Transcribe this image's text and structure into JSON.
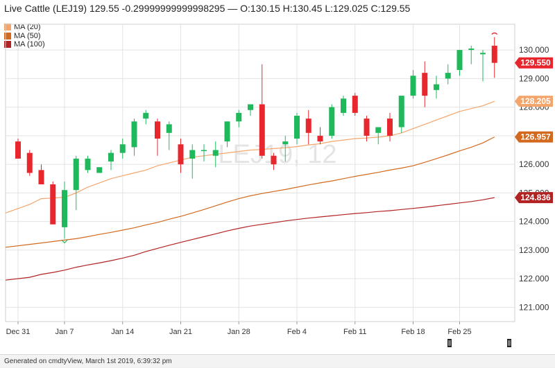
{
  "header": {
    "title": "Live Cattle (LEJ19) 129.55 -0.29999999999998295 — O:130.15 H:130.45 L:129.025 C:129.55"
  },
  "legend": [
    {
      "label": "MA (20)",
      "color": "#f4a56b"
    },
    {
      "label": "MA (50)",
      "color": "#d2691e"
    },
    {
      "label": "MA (100)",
      "color": "#b22222"
    }
  ],
  "watermark": "LEJ19, 12",
  "footer": {
    "text": "Generated on cmdtyView, March 1st 2019, 6:39:32 pm"
  },
  "colors": {
    "up": "#1fb85a",
    "down": "#e8262d"
  },
  "chart_data": {
    "type": "candlestick",
    "ylim": [
      120.5,
      130.9
    ],
    "yticks": [
      121,
      122,
      123,
      124,
      125,
      126,
      127,
      128,
      129,
      130
    ],
    "ytick_labels": [
      "121.000",
      "122.000",
      "123.000",
      "124.000",
      "125.000",
      "126.000",
      "127.000",
      "128.000",
      "129.000",
      "130.000"
    ],
    "x_labels": [
      {
        "index": 0,
        "label": "Dec 31"
      },
      {
        "index": 4,
        "label": "Jan 7"
      },
      {
        "index": 9,
        "label": "Jan 14"
      },
      {
        "index": 14,
        "label": "Jan 21"
      },
      {
        "index": 19,
        "label": "Jan 28"
      },
      {
        "index": 24,
        "label": "Feb 4"
      },
      {
        "index": 29,
        "label": "Feb 11"
      },
      {
        "index": 34,
        "label": "Feb 18"
      },
      {
        "index": 38,
        "label": "Feb 25"
      }
    ],
    "candles": [
      {
        "o": 126.8,
        "h": 126.9,
        "l": 126.3,
        "c": 126.2
      },
      {
        "o": 126.4,
        "h": 126.5,
        "l": 125.6,
        "c": 125.7
      },
      {
        "o": 125.8,
        "h": 126.0,
        "l": 125.4,
        "c": 125.3
      },
      {
        "o": 125.3,
        "h": 125.4,
        "l": 123.9,
        "c": 123.9
      },
      {
        "o": 123.8,
        "h": 125.4,
        "l": 123.4,
        "c": 125.1
      },
      {
        "o": 125.1,
        "h": 126.3,
        "l": 124.4,
        "c": 126.2
      },
      {
        "o": 125.8,
        "h": 126.3,
        "l": 125.7,
        "c": 126.2
      },
      {
        "o": 125.7,
        "h": 125.9,
        "l": 125.7,
        "c": 125.9
      },
      {
        "o": 126.1,
        "h": 126.5,
        "l": 125.8,
        "c": 126.4
      },
      {
        "o": 126.4,
        "h": 126.9,
        "l": 126.2,
        "c": 126.7
      },
      {
        "o": 126.6,
        "h": 127.6,
        "l": 126.3,
        "c": 127.5
      },
      {
        "o": 127.6,
        "h": 127.9,
        "l": 127.4,
        "c": 127.8
      },
      {
        "o": 127.5,
        "h": 127.6,
        "l": 126.3,
        "c": 126.9
      },
      {
        "o": 127.1,
        "h": 127.5,
        "l": 126.5,
        "c": 127.4
      },
      {
        "o": 126.7,
        "h": 126.9,
        "l": 125.7,
        "c": 126.0
      },
      {
        "o": 126.2,
        "h": 126.7,
        "l": 125.5,
        "c": 126.5
      },
      {
        "o": 126.5,
        "h": 126.7,
        "l": 126.1,
        "c": 126.5
      },
      {
        "o": 126.3,
        "h": 126.8,
        "l": 125.9,
        "c": 126.5
      },
      {
        "o": 126.8,
        "h": 127.5,
        "l": 126.6,
        "c": 127.5
      },
      {
        "o": 127.5,
        "h": 127.9,
        "l": 127.3,
        "c": 127.8
      },
      {
        "o": 127.9,
        "h": 128.1,
        "l": 127.7,
        "c": 128.1
      },
      {
        "o": 128.1,
        "h": 129.5,
        "l": 126.2,
        "c": 126.3
      },
      {
        "o": 126.3,
        "h": 126.4,
        "l": 125.8,
        "c": 126.0
      },
      {
        "o": 126.7,
        "h": 127.0,
        "l": 126.1,
        "c": 126.8
      },
      {
        "o": 126.9,
        "h": 127.8,
        "l": 126.7,
        "c": 127.7
      },
      {
        "o": 127.6,
        "h": 127.9,
        "l": 126.7,
        "c": 127.1
      },
      {
        "o": 127.0,
        "h": 127.3,
        "l": 126.7,
        "c": 126.8
      },
      {
        "o": 127.0,
        "h": 128.1,
        "l": 126.9,
        "c": 128.0
      },
      {
        "o": 127.8,
        "h": 128.4,
        "l": 127.7,
        "c": 128.3
      },
      {
        "o": 128.4,
        "h": 128.5,
        "l": 127.7,
        "c": 127.8
      },
      {
        "o": 127.6,
        "h": 127.7,
        "l": 126.8,
        "c": 127.0
      },
      {
        "o": 127.1,
        "h": 127.3,
        "l": 126.7,
        "c": 127.3
      },
      {
        "o": 127.6,
        "h": 127.8,
        "l": 126.8,
        "c": 127.0
      },
      {
        "o": 127.3,
        "h": 128.4,
        "l": 127.1,
        "c": 128.4
      },
      {
        "o": 128.4,
        "h": 129.3,
        "l": 128.3,
        "c": 129.1
      },
      {
        "o": 129.2,
        "h": 129.6,
        "l": 128.0,
        "c": 128.4
      },
      {
        "o": 128.6,
        "h": 129.1,
        "l": 128.3,
        "c": 128.8
      },
      {
        "o": 129.0,
        "h": 129.5,
        "l": 128.8,
        "c": 129.2
      },
      {
        "o": 129.3,
        "h": 130.0,
        "l": 129.1,
        "c": 130.0
      },
      {
        "o": 130.0,
        "h": 130.15,
        "l": 129.5,
        "c": 130.05
      },
      {
        "o": 129.85,
        "h": 130.0,
        "l": 128.9,
        "c": 129.9
      },
      {
        "o": 130.15,
        "h": 130.45,
        "l": 129.025,
        "c": 129.55
      }
    ],
    "series": [
      {
        "name": "MA (20)",
        "color": "#f4a56b",
        "last": "128.205",
        "values": [
          124.3,
          124.6,
          124.8,
          124.82,
          124.85,
          125.0,
          125.2,
          125.35,
          125.5,
          125.6,
          125.7,
          125.8,
          125.95,
          126.05,
          126.15,
          126.25,
          126.3,
          126.35,
          126.4,
          126.45,
          126.5,
          126.52,
          126.55,
          126.58,
          126.62,
          126.68,
          126.72,
          126.8,
          126.85,
          126.9,
          126.92,
          126.95,
          127.0,
          127.1,
          127.25,
          127.4,
          127.55,
          127.7,
          127.85,
          127.95,
          128.05,
          128.205
        ]
      },
      {
        "name": "MA (50)",
        "color": "#d2691e",
        "last": "126.957",
        "values": [
          123.1,
          123.2,
          123.25,
          123.3,
          123.35,
          123.4,
          123.47,
          123.55,
          123.62,
          123.7,
          123.78,
          123.88,
          123.97,
          124.08,
          124.18,
          124.3,
          124.42,
          124.55,
          124.68,
          124.8,
          124.9,
          124.98,
          125.05,
          125.12,
          125.2,
          125.28,
          125.35,
          125.42,
          125.5,
          125.58,
          125.65,
          125.72,
          125.8,
          125.87,
          125.95,
          126.07,
          126.2,
          126.33,
          126.47,
          126.6,
          126.75,
          126.957
        ]
      },
      {
        "name": "MA (100)",
        "color": "#b22222",
        "last": "124.836",
        "values": [
          121.95,
          122.05,
          122.15,
          122.22,
          122.3,
          122.4,
          122.48,
          122.55,
          122.63,
          122.72,
          122.82,
          122.95,
          123.06,
          123.17,
          123.27,
          123.37,
          123.47,
          123.57,
          123.67,
          123.76,
          123.84,
          123.9,
          123.96,
          124.02,
          124.07,
          124.12,
          124.16,
          124.2,
          124.24,
          124.28,
          124.31,
          124.35,
          124.38,
          124.42,
          124.46,
          124.5,
          124.55,
          124.6,
          124.65,
          124.7,
          124.76,
          124.836
        ]
      }
    ],
    "last_price": "129.550"
  }
}
